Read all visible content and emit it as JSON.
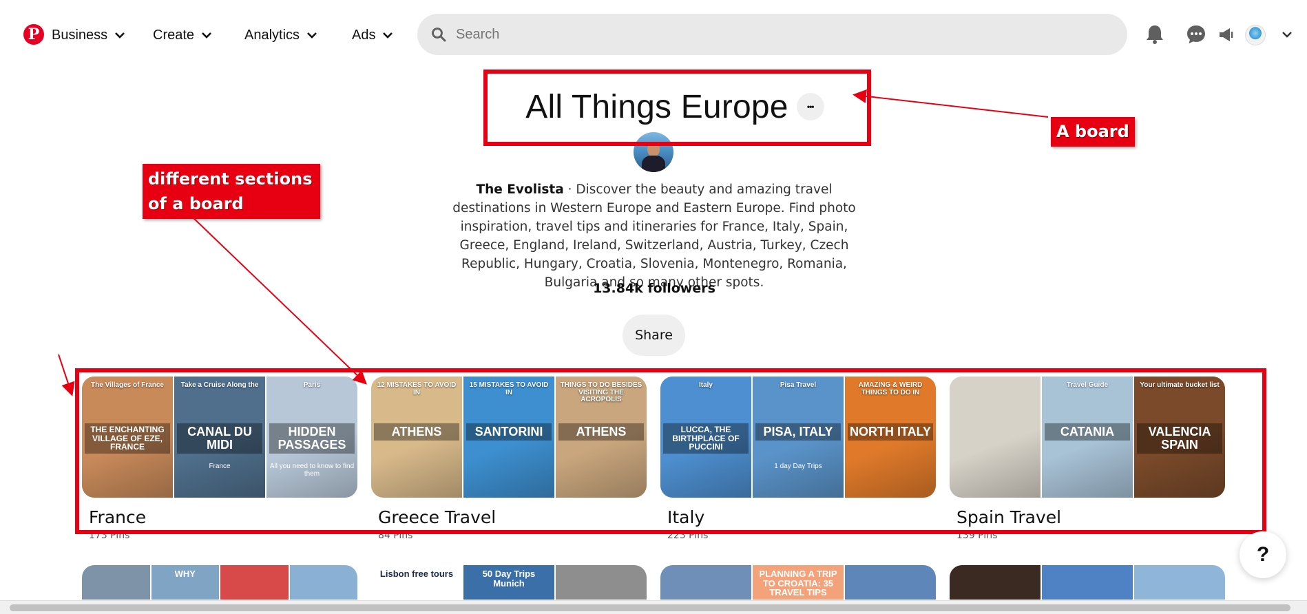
{
  "header": {
    "logo_letter": "P",
    "nav": [
      {
        "label": "Business"
      },
      {
        "label": "Create"
      },
      {
        "label": "Analytics"
      },
      {
        "label": "Ads"
      }
    ],
    "search_placeholder": "Search"
  },
  "board": {
    "title": "All Things Europe",
    "more_label": "•••",
    "owner": "The Evolista",
    "separator": " · ",
    "description": "Discover the beauty and amazing travel destinations in Western Europe and Eastern Europe. Find photo inspiration, travel tips and itineraries for France, Italy, Spain, Greece, England, Ireland, Switzerland, Austria, Turkey, Czech Republic, Hungary, Croatia, Slovenia, Montenegro, Romania, Bulgaria and so many other spots.",
    "followers": "13.84k followers",
    "share_label": "Share"
  },
  "sections": [
    {
      "name": "France",
      "count": "173 Pins",
      "tiles": [
        {
          "color": "#c98a5a",
          "text": "THE ENCHANTING VILLAGE OF EZE, FRANCE",
          "top_text": "The Villages of France"
        },
        {
          "color": "#4f6f8c",
          "text": "CANAL DU MIDI",
          "top_text": "Take a Cruise Along the",
          "sub": "France"
        },
        {
          "color": "#b7c7d8",
          "text": "HIDDEN PASSAGES",
          "top_text": "Paris",
          "sub": "All you need to know to find them"
        }
      ]
    },
    {
      "name": "Greece Travel",
      "count": "84 Pins",
      "tiles": [
        {
          "color": "#d8b98a",
          "text": "ATHENS",
          "top_text": "12 MISTAKES TO AVOID IN"
        },
        {
          "color": "#3d8fd0",
          "text": "SANTORINI",
          "top_text": "15 MISTAKES TO AVOID IN"
        },
        {
          "color": "#c9a67d",
          "text": "ATHENS",
          "top_text": "THINGS TO DO BESIDES VISITING THE ACROPOLIS"
        }
      ]
    },
    {
      "name": "Italy",
      "count": "223 Pins",
      "tiles": [
        {
          "color": "#4d8fd0",
          "text": "LUCCA, THE BIRTHPLACE OF PUCCINI",
          "top_text": "Italy"
        },
        {
          "color": "#5a93c9",
          "text": "PISA, ITALY",
          "top_text": "Pisa Travel",
          "sub": "1 day Day Trips"
        },
        {
          "color": "#e07a2a",
          "text": "NORTH ITALY",
          "top_text": "AMAZING & WEIRD THINGS TO DO IN"
        }
      ]
    },
    {
      "name": "Spain Travel",
      "count": "139 Pins",
      "tiles": [
        {
          "color": "#d7d2c8",
          "text": "",
          "top_text": ""
        },
        {
          "color": "#a8c2d6",
          "text": "CATANIA",
          "top_text": "Travel Guide"
        },
        {
          "color": "#7a4a2a",
          "text": "VALENCIA SPAIN",
          "top_text": "Your ultimate bucket list"
        }
      ]
    }
  ],
  "row2": [
    {
      "tiles": [
        {
          "color": "#7f93a8",
          "text": ""
        },
        {
          "color": "#7fa4c4",
          "text": "WHY"
        },
        {
          "color": "#d84a4a",
          "text": ""
        },
        {
          "color": "#8ab0d4",
          "text": ""
        }
      ]
    },
    {
      "tiles": [
        {
          "color": "#ffffff",
          "text": "Lisbon free tours"
        },
        {
          "color": "#3b6fa8",
          "text": "50 Day Trips Munich"
        },
        {
          "color": "#8e8e8e",
          "text": ""
        }
      ]
    },
    {
      "tiles": [
        {
          "color": "#6f8fb8",
          "text": ""
        },
        {
          "color": "#f4a27a",
          "text": "PLANNING A TRIP TO CROATIA: 35 TRAVEL TIPS"
        },
        {
          "color": "#5f86b8",
          "text": ""
        }
      ]
    },
    {
      "tiles": [
        {
          "color": "#3a2a22",
          "text": ""
        },
        {
          "color": "#4f82c4",
          "text": ""
        },
        {
          "color": "#8fb5d9",
          "text": ""
        }
      ]
    }
  ],
  "annotations": {
    "board_label": "A board",
    "sections_label_line1": "different sections",
    "sections_label_line2": "of a board",
    "annotation_color": "#e60012"
  },
  "help_label": "?",
  "accent": "#e60023"
}
